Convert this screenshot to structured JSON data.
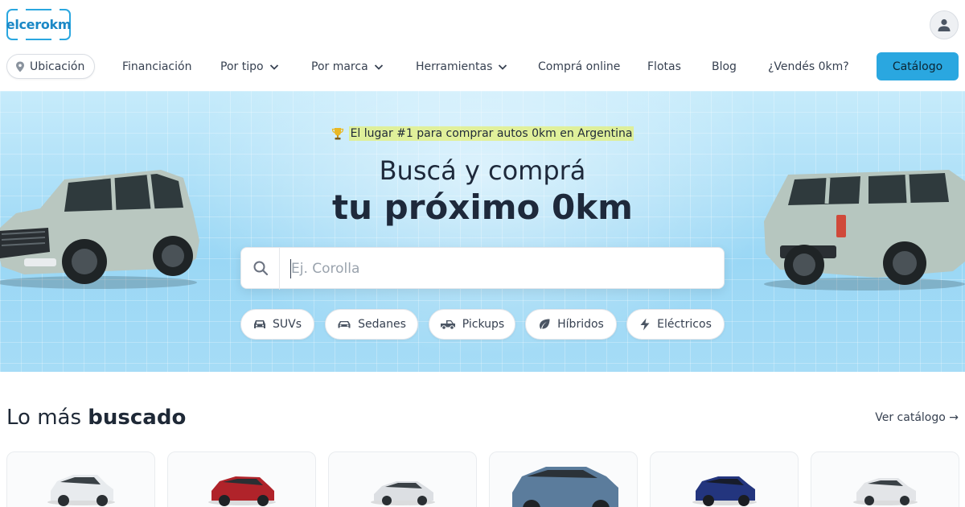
{
  "brand": {
    "logo_text": "elcerokm"
  },
  "header": {
    "avatar_icon": "user-icon"
  },
  "nav": {
    "location_label": "Ubicación",
    "items": [
      {
        "label": "Financiación",
        "dropdown": false
      },
      {
        "label": "Por tipo",
        "dropdown": true
      },
      {
        "label": "Por marca",
        "dropdown": true
      },
      {
        "label": "Herramientas",
        "dropdown": true
      },
      {
        "label": "Comprá online",
        "dropdown": false
      },
      {
        "label": "Flotas",
        "dropdown": false
      },
      {
        "label": "Blog",
        "dropdown": false
      },
      {
        "label": "¿Vendés 0km?",
        "dropdown": false
      }
    ],
    "catalog_label": "Catálogo"
  },
  "hero": {
    "tagline_icon": "trophy-icon",
    "tagline": "El lugar #1 para comprar autos 0km en Argentina",
    "title_line1": "Buscá y comprá",
    "title_line2": "tu próximo 0km",
    "search_placeholder": "Ej. Corolla",
    "chips": [
      {
        "label": "SUVs",
        "icon": "suv-icon"
      },
      {
        "label": "Sedanes",
        "icon": "sedan-icon"
      },
      {
        "label": "Pickups",
        "icon": "pickup-icon"
      },
      {
        "label": "Híbridos",
        "icon": "leaf-icon"
      },
      {
        "label": "Eléctricos",
        "icon": "bolt-icon"
      }
    ]
  },
  "section": {
    "title_regular": "Lo más",
    "title_bold": "buscado",
    "see_all": "Ver catálogo →"
  },
  "colors": {
    "accent": "#2aa7e0",
    "hero_bg": "#9ad7f5",
    "car_bodies": [
      "#e8ebee",
      "#b0232a",
      "#dcdfe3",
      "#5b7c9c",
      "#23357e",
      "#e3e5e8"
    ]
  }
}
